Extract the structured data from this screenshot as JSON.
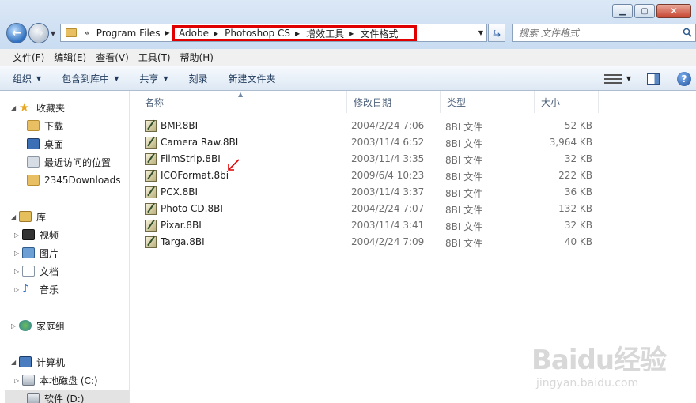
{
  "window": {
    "minimize_icon": "minimize-icon",
    "maximize_icon": "maximize-icon",
    "close_icon": "close-icon"
  },
  "address": {
    "prefix": "«",
    "segments": [
      "Program Files",
      "Adobe",
      "Photoshop CS",
      "增效工具",
      "文件格式"
    ]
  },
  "search": {
    "placeholder": "搜索 文件格式"
  },
  "menu": [
    "文件(F)",
    "编辑(E)",
    "查看(V)",
    "工具(T)",
    "帮助(H)"
  ],
  "toolbar": {
    "organize": "组织",
    "include_library": "包含到库中",
    "share": "共享",
    "burn": "刻录",
    "new_folder": "新建文件夹"
  },
  "nav": {
    "favorites": "收藏夹",
    "downloads": "下载",
    "desktop": "桌面",
    "recent": "最近访问的位置",
    "downloads2345": "2345Downloads",
    "libraries": "库",
    "videos": "视频",
    "pictures": "图片",
    "documents": "文档",
    "music": "音乐",
    "homegroup": "家庭组",
    "computer": "计算机",
    "local_c": "本地磁盘 (C:)",
    "soft_d": "软件 (D:)"
  },
  "columns": {
    "name": "名称",
    "date": "修改日期",
    "type": "类型",
    "size": "大小"
  },
  "files": [
    {
      "name": "BMP.8BI",
      "date": "2004/2/24 7:06",
      "type": "8BI 文件",
      "size": "52 KB"
    },
    {
      "name": "Camera Raw.8BI",
      "date": "2003/11/4 6:52",
      "type": "8BI 文件",
      "size": "3,964 KB"
    },
    {
      "name": "FilmStrip.8BI",
      "date": "2003/11/4 3:35",
      "type": "8BI 文件",
      "size": "32 KB"
    },
    {
      "name": "ICOFormat.8bi",
      "date": "2009/6/4 10:23",
      "type": "8BI 文件",
      "size": "222 KB"
    },
    {
      "name": "PCX.8BI",
      "date": "2003/11/4 3:37",
      "type": "8BI 文件",
      "size": "36 KB"
    },
    {
      "name": "Photo CD.8BI",
      "date": "2004/2/24 7:07",
      "type": "8BI 文件",
      "size": "132 KB"
    },
    {
      "name": "Pixar.8BI",
      "date": "2003/11/4 3:41",
      "type": "8BI 文件",
      "size": "32 KB"
    },
    {
      "name": "Targa.8BI",
      "date": "2004/2/24 7:09",
      "type": "8BI 文件",
      "size": "40 KB"
    }
  ],
  "watermark": {
    "main": "Baidu经验",
    "sub": "jingyan.baidu.com"
  },
  "colors": {
    "highlight_box": "#e00000",
    "annotation_arrow": "#e00000"
  }
}
